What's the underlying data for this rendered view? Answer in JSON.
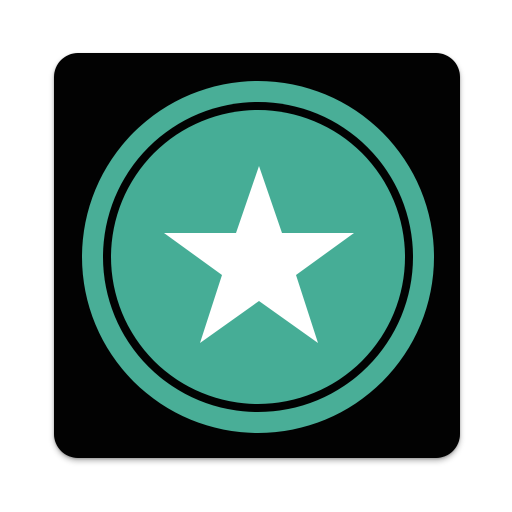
{
  "app_icon": {
    "icon": "star-badge-icon",
    "colors": {
      "tile_background": "#020202",
      "ring": "#49ae97",
      "inner_disc": "#46ad96",
      "gap": "#020202",
      "star": "#ffffff"
    }
  }
}
